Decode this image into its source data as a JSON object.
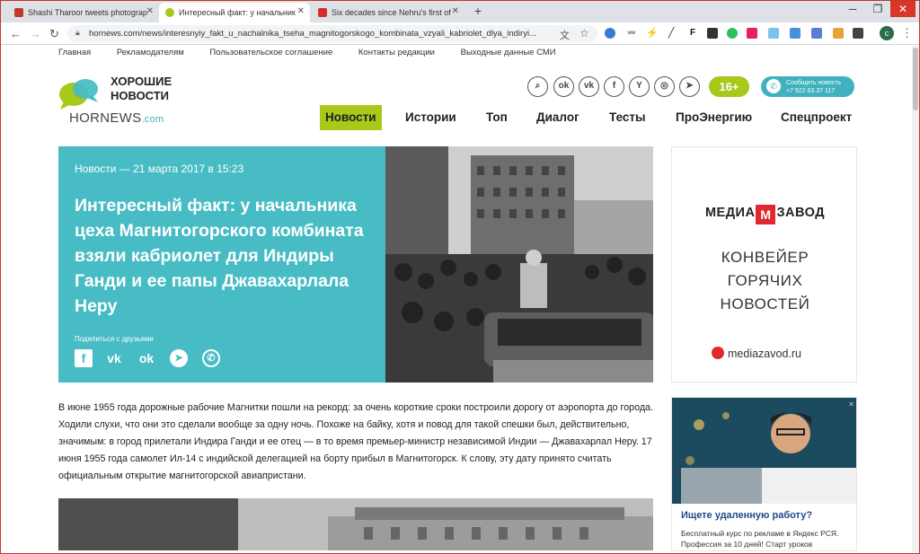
{
  "browser": {
    "tabs": [
      {
        "title": "Shashi Tharoor tweets photograp",
        "favicon_color": "#c0392b"
      },
      {
        "title": "Интересный факт: у начальник",
        "favicon_color": "#a8c81a"
      },
      {
        "title": "Six decades since Nehru's first of",
        "favicon_color": "#d32f2f"
      }
    ],
    "new_tab": "+",
    "url": "hornews.com/news/interesnyiy_fakt_u_nachalnika_tseha_magnitogorskogo_kombinata_vzyali_kabriolet_dlya_indiryi...",
    "profile_initial": "c"
  },
  "topnav": [
    "Главная",
    "Рекламодателям",
    "Пользовательское соглашение",
    "Контакты редакции",
    "Выходные данные СМИ"
  ],
  "logo": {
    "line1": "ХОРОШИЕ",
    "line2": "НОВОСТИ",
    "domain": "HORNEWS",
    "tld": ".com"
  },
  "age_badge": "16+",
  "report": {
    "line1": "Сообщить новость",
    "line2": "+7 922 63 37 117"
  },
  "mainnav": [
    "Новости",
    "Истории",
    "Топ",
    "Диалог",
    "Тесты",
    "ПроЭнергию",
    "Спецпроект"
  ],
  "hero": {
    "meta": "Новости — 21 марта 2017 в 15:23",
    "title": "Интересный факт: у начальника цеха Магнитогорского комбината взяли кабриолет для Индиры Ганди и ее папы Джавахарлала Неру",
    "share_label": "Поделиться с друзьями"
  },
  "article": {
    "p1": "В июне 1955 года дорожные рабочие Магнитки пошли на рекорд: за очень короткие сроки построили дорогу от аэропорта до города. Ходили слухи, что они это сделали вообще за одну ночь. Похоже на байку, хотя и повод для такой спешки был, действительно, значимым: в город прилетали Индира Ганди и ее отец — в то время премьер-министр независимой Индии — Джавахарлал Неру. 17 июня 1955 года самолет Ил-14 с индийской делегацией на борту прибыл в Магнитогорск. К слову, эту дату принято считать официальным открытие магнитогорской авиапристани."
  },
  "ad1": {
    "brand_left": "МЕДИА",
    "brand_mark": "М",
    "brand_right": "ЗАВОД",
    "slogan1": "КОНВЕЙЕР",
    "slogan2": "ГОРЯЧИХ",
    "slogan3": "НОВОСТЕЙ",
    "site": "mediazavod.ru"
  },
  "ad2": {
    "title": "Ищете удаленную работу?",
    "text": "Бесплатный курс по рекламе в Яндекс РСЯ. Профессия за 10 дней! Старт уроков"
  },
  "colors": {
    "accent_green": "#a8c81a",
    "accent_teal": "#47bcc4"
  }
}
